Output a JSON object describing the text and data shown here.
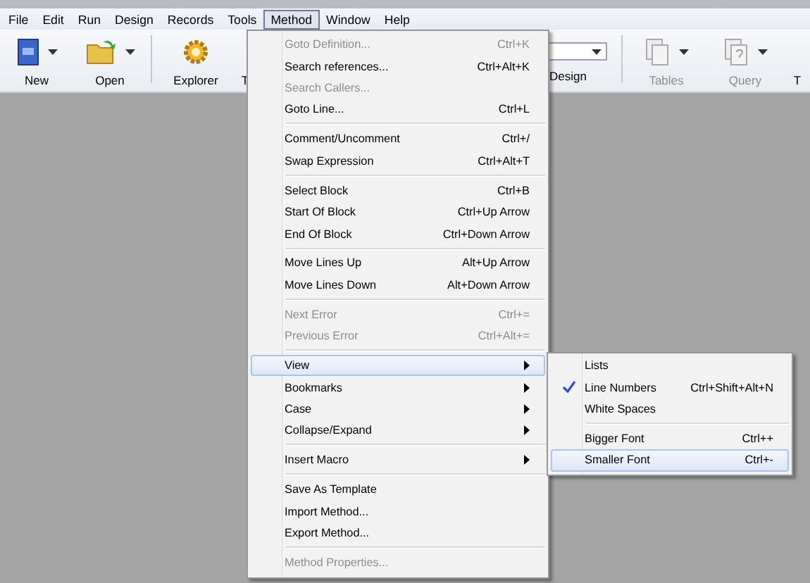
{
  "menubar": [
    {
      "label": "File",
      "selected": false
    },
    {
      "label": "Edit",
      "selected": false
    },
    {
      "label": "Run",
      "selected": false
    },
    {
      "label": "Design",
      "selected": false
    },
    {
      "label": "Records",
      "selected": false
    },
    {
      "label": "Tools",
      "selected": false
    },
    {
      "label": "Method",
      "selected": true
    },
    {
      "label": "Window",
      "selected": false
    },
    {
      "label": "Help",
      "selected": false
    }
  ],
  "toolbar": {
    "left": [
      {
        "kind": "new",
        "label": "New",
        "dropdown": true,
        "disabled": false
      },
      {
        "kind": "open",
        "label": "Open",
        "dropdown": true,
        "disabled": false
      },
      {
        "kind": "explorer",
        "label": "Explorer",
        "dropdown": false,
        "disabled": false
      },
      {
        "kind": "cut",
        "label": "T",
        "dropdown": false,
        "disabled": false
      }
    ],
    "mode_label": "Design",
    "right": [
      {
        "kind": "tables",
        "label": "Tables",
        "dropdown": true,
        "disabled": true
      },
      {
        "kind": "query",
        "label": "Query",
        "dropdown": true,
        "disabled": true
      },
      {
        "kind": "cut",
        "label": "T",
        "dropdown": false,
        "disabled": false
      }
    ]
  },
  "menu": {
    "items": [
      {
        "kind": "item",
        "label": "Goto Definition...",
        "shortcut": "Ctrl+K",
        "disabled": true,
        "submenu": false,
        "selected": false
      },
      {
        "kind": "item",
        "label": "Search references...",
        "shortcut": "Ctrl+Alt+K",
        "disabled": false,
        "submenu": false,
        "selected": false
      },
      {
        "kind": "item",
        "label": "Search Callers...",
        "disabled": true,
        "submenu": false,
        "selected": false
      },
      {
        "kind": "item",
        "label": "Goto Line...",
        "shortcut": "Ctrl+L",
        "disabled": false,
        "submenu": false,
        "selected": false
      },
      {
        "kind": "separator"
      },
      {
        "kind": "item",
        "label": "Comment/Uncomment",
        "shortcut": "Ctrl+/",
        "disabled": false,
        "submenu": false,
        "selected": false
      },
      {
        "kind": "item",
        "label": "Swap Expression",
        "shortcut": "Ctrl+Alt+T",
        "disabled": false,
        "submenu": false,
        "selected": false
      },
      {
        "kind": "separator"
      },
      {
        "kind": "item",
        "label": "Select Block",
        "shortcut": "Ctrl+B",
        "disabled": false,
        "submenu": false,
        "selected": false
      },
      {
        "kind": "item",
        "label": "Start Of Block",
        "shortcut": "Ctrl+Up Arrow",
        "disabled": false,
        "submenu": false,
        "selected": false
      },
      {
        "kind": "item",
        "label": "End Of Block",
        "shortcut": "Ctrl+Down Arrow",
        "disabled": false,
        "submenu": false,
        "selected": false
      },
      {
        "kind": "separator"
      },
      {
        "kind": "item",
        "label": "Move Lines Up",
        "shortcut": "Alt+Up Arrow",
        "disabled": false,
        "submenu": false,
        "selected": false
      },
      {
        "kind": "item",
        "label": "Move Lines Down",
        "shortcut": "Alt+Down Arrow",
        "disabled": false,
        "submenu": false,
        "selected": false
      },
      {
        "kind": "separator"
      },
      {
        "kind": "item",
        "label": "Next Error",
        "shortcut": "Ctrl+=",
        "disabled": true,
        "submenu": false,
        "selected": false
      },
      {
        "kind": "item",
        "label": "Previous Error",
        "shortcut": "Ctrl+Alt+=",
        "disabled": true,
        "submenu": false,
        "selected": false
      },
      {
        "kind": "separator"
      },
      {
        "kind": "item",
        "label": "View",
        "disabled": false,
        "submenu": true,
        "selected": true
      },
      {
        "kind": "item",
        "label": "Bookmarks",
        "disabled": false,
        "submenu": true,
        "selected": false
      },
      {
        "kind": "item",
        "label": "Case",
        "disabled": false,
        "submenu": true,
        "selected": false
      },
      {
        "kind": "item",
        "label": "Collapse/Expand",
        "disabled": false,
        "submenu": true,
        "selected": false
      },
      {
        "kind": "separator"
      },
      {
        "kind": "item",
        "label": "Insert Macro",
        "disabled": false,
        "submenu": true,
        "selected": false
      },
      {
        "kind": "separator"
      },
      {
        "kind": "item",
        "label": "Save As Template",
        "disabled": false,
        "submenu": false,
        "selected": false
      },
      {
        "kind": "item",
        "label": "Import Method...",
        "disabled": false,
        "submenu": false,
        "selected": false
      },
      {
        "kind": "item",
        "label": "Export Method...",
        "disabled": false,
        "submenu": false,
        "selected": false
      },
      {
        "kind": "separator"
      },
      {
        "kind": "item",
        "label": "Method Properties...",
        "disabled": true,
        "submenu": false,
        "selected": false
      }
    ]
  },
  "submenu": {
    "items": [
      {
        "kind": "item",
        "label": "Lists",
        "checked": false,
        "selected": false
      },
      {
        "kind": "item",
        "label": "Line Numbers",
        "shortcut": "Ctrl+Shift+Alt+N",
        "checked": true,
        "selected": false
      },
      {
        "kind": "item",
        "label": "White Spaces",
        "checked": false,
        "selected": false
      },
      {
        "kind": "separator"
      },
      {
        "kind": "item",
        "label": "Bigger Font",
        "shortcut": "Ctrl++",
        "checked": false,
        "selected": false
      },
      {
        "kind": "item",
        "label": "Smaller Font",
        "shortcut": "Ctrl+-",
        "checked": false,
        "selected": true
      }
    ]
  }
}
